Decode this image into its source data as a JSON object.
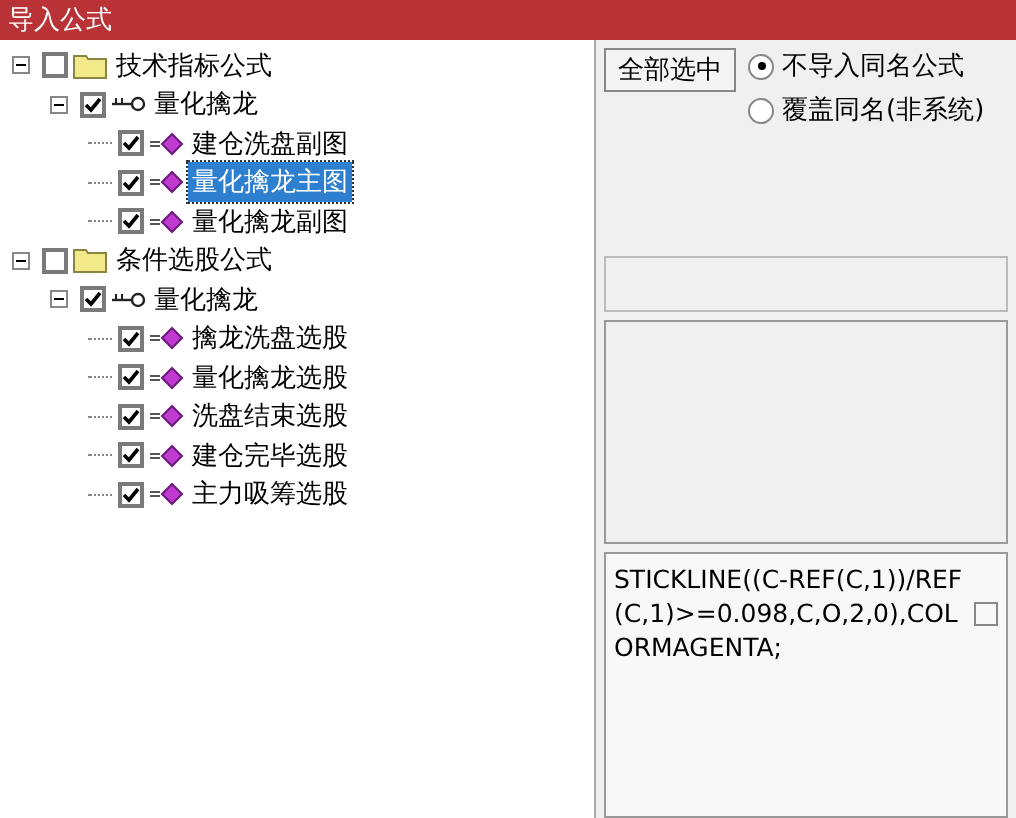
{
  "window": {
    "title": "导入公式"
  },
  "tree": [
    {
      "label": "技术指标公式",
      "kind": "folder",
      "checked": false,
      "expanded": true,
      "selected": false,
      "children": [
        {
          "label": "量化擒龙",
          "kind": "group",
          "checked": true,
          "expanded": true,
          "selected": false,
          "children": [
            {
              "label": "建仓洗盘副图",
              "kind": "formula",
              "checked": true,
              "selected": false
            },
            {
              "label": "量化擒龙主图",
              "kind": "formula",
              "checked": true,
              "selected": true
            },
            {
              "label": "量化擒龙副图",
              "kind": "formula",
              "checked": true,
              "selected": false
            }
          ]
        }
      ]
    },
    {
      "label": "条件选股公式",
      "kind": "folder",
      "checked": false,
      "expanded": true,
      "selected": false,
      "children": [
        {
          "label": "量化擒龙",
          "kind": "group",
          "checked": true,
          "expanded": true,
          "selected": false,
          "children": [
            {
              "label": "擒龙洗盘选股",
              "kind": "formula",
              "checked": true,
              "selected": false
            },
            {
              "label": "量化擒龙选股",
              "kind": "formula",
              "checked": true,
              "selected": false
            },
            {
              "label": "洗盘结束选股",
              "kind": "formula",
              "checked": true,
              "selected": false
            },
            {
              "label": "建仓完毕选股",
              "kind": "formula",
              "checked": true,
              "selected": false
            },
            {
              "label": "主力吸筹选股",
              "kind": "formula",
              "checked": true,
              "selected": false
            }
          ]
        }
      ]
    }
  ],
  "select_all_button": "全部选中",
  "options": [
    {
      "label": "不导入同名公式",
      "selected": true
    },
    {
      "label": "覆盖同名(非系统)",
      "selected": false
    }
  ],
  "formula_text": "STICKLINE((C-REF(C,1))/REF(C,1)>=0.098,C,O,2,0),COLORMAGENTA;"
}
